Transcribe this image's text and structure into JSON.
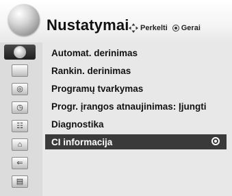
{
  "header": {
    "title": "Nustatymai",
    "move_hint": "Perkelti",
    "ok_hint": "Gerai",
    "logo_icon": "satellite-globe-icon"
  },
  "sidebar": {
    "icons": [
      {
        "name": "setup-icon",
        "glyph": "◐",
        "active": true
      },
      {
        "name": "picture-icon",
        "glyph": "▭",
        "active": false
      },
      {
        "name": "sound-icon",
        "glyph": "◎",
        "active": false
      },
      {
        "name": "time-icon",
        "glyph": "◷",
        "active": false
      },
      {
        "name": "option-icon",
        "glyph": "☷",
        "active": false
      },
      {
        "name": "lock-icon",
        "glyph": "🔒︎",
        "active": false
      },
      {
        "name": "input-icon",
        "glyph": "⇐",
        "active": false
      },
      {
        "name": "usb-media-icon",
        "glyph": "▤",
        "active": false
      }
    ]
  },
  "menu": {
    "items": [
      {
        "label": "Automat. derinimas",
        "selected": false
      },
      {
        "label": "Rankin. derinimas",
        "selected": false
      },
      {
        "label": "Programų tvarkymas",
        "selected": false
      },
      {
        "label": "Progr. įrangos atnaujinimas: Įjungti",
        "selected": false
      },
      {
        "label": "Diagnostika",
        "selected": false
      },
      {
        "label": "CI informacija",
        "selected": true
      }
    ]
  },
  "colors": {
    "selected_bg": "#3a3a3a",
    "menu_bg": "#e8e8e8",
    "sidebar_bg": "#dcdcdc"
  }
}
